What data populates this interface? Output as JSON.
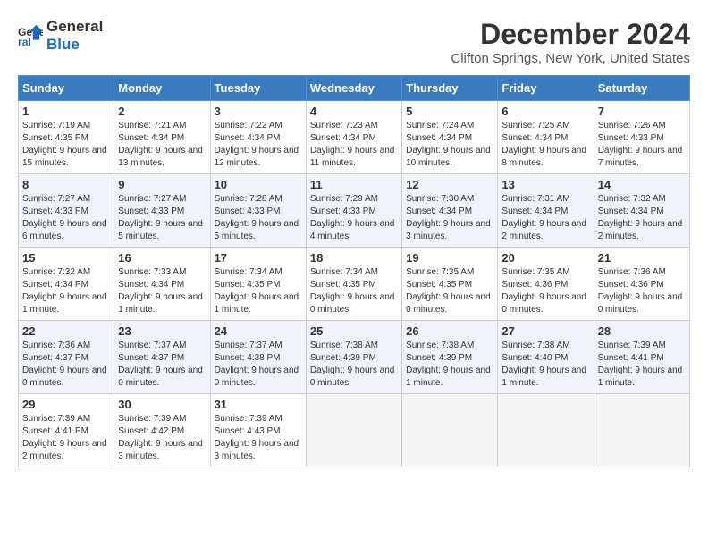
{
  "logo": {
    "line1": "General",
    "line2": "Blue"
  },
  "title": "December 2024",
  "subtitle": "Clifton Springs, New York, United States",
  "days_of_week": [
    "Sunday",
    "Monday",
    "Tuesday",
    "Wednesday",
    "Thursday",
    "Friday",
    "Saturday"
  ],
  "weeks": [
    [
      {
        "day": 1,
        "sunrise": "7:19 AM",
        "sunset": "4:35 PM",
        "daylight": "9 hours and 15 minutes."
      },
      {
        "day": 2,
        "sunrise": "7:21 AM",
        "sunset": "4:34 PM",
        "daylight": "9 hours and 13 minutes."
      },
      {
        "day": 3,
        "sunrise": "7:22 AM",
        "sunset": "4:34 PM",
        "daylight": "9 hours and 12 minutes."
      },
      {
        "day": 4,
        "sunrise": "7:23 AM",
        "sunset": "4:34 PM",
        "daylight": "9 hours and 11 minutes."
      },
      {
        "day": 5,
        "sunrise": "7:24 AM",
        "sunset": "4:34 PM",
        "daylight": "9 hours and 10 minutes."
      },
      {
        "day": 6,
        "sunrise": "7:25 AM",
        "sunset": "4:34 PM",
        "daylight": "9 hours and 8 minutes."
      },
      {
        "day": 7,
        "sunrise": "7:26 AM",
        "sunset": "4:33 PM",
        "daylight": "9 hours and 7 minutes."
      }
    ],
    [
      {
        "day": 8,
        "sunrise": "7:27 AM",
        "sunset": "4:33 PM",
        "daylight": "9 hours and 6 minutes."
      },
      {
        "day": 9,
        "sunrise": "7:27 AM",
        "sunset": "4:33 PM",
        "daylight": "9 hours and 5 minutes."
      },
      {
        "day": 10,
        "sunrise": "7:28 AM",
        "sunset": "4:33 PM",
        "daylight": "9 hours and 5 minutes."
      },
      {
        "day": 11,
        "sunrise": "7:29 AM",
        "sunset": "4:33 PM",
        "daylight": "9 hours and 4 minutes."
      },
      {
        "day": 12,
        "sunrise": "7:30 AM",
        "sunset": "4:34 PM",
        "daylight": "9 hours and 3 minutes."
      },
      {
        "day": 13,
        "sunrise": "7:31 AM",
        "sunset": "4:34 PM",
        "daylight": "9 hours and 2 minutes."
      },
      {
        "day": 14,
        "sunrise": "7:32 AM",
        "sunset": "4:34 PM",
        "daylight": "9 hours and 2 minutes."
      }
    ],
    [
      {
        "day": 15,
        "sunrise": "7:32 AM",
        "sunset": "4:34 PM",
        "daylight": "9 hours and 1 minute."
      },
      {
        "day": 16,
        "sunrise": "7:33 AM",
        "sunset": "4:34 PM",
        "daylight": "9 hours and 1 minute."
      },
      {
        "day": 17,
        "sunrise": "7:34 AM",
        "sunset": "4:35 PM",
        "daylight": "9 hours and 1 minute."
      },
      {
        "day": 18,
        "sunrise": "7:34 AM",
        "sunset": "4:35 PM",
        "daylight": "9 hours and 0 minutes."
      },
      {
        "day": 19,
        "sunrise": "7:35 AM",
        "sunset": "4:35 PM",
        "daylight": "9 hours and 0 minutes."
      },
      {
        "day": 20,
        "sunrise": "7:35 AM",
        "sunset": "4:36 PM",
        "daylight": "9 hours and 0 minutes."
      },
      {
        "day": 21,
        "sunrise": "7:36 AM",
        "sunset": "4:36 PM",
        "daylight": "9 hours and 0 minutes."
      }
    ],
    [
      {
        "day": 22,
        "sunrise": "7:36 AM",
        "sunset": "4:37 PM",
        "daylight": "9 hours and 0 minutes."
      },
      {
        "day": 23,
        "sunrise": "7:37 AM",
        "sunset": "4:37 PM",
        "daylight": "9 hours and 0 minutes."
      },
      {
        "day": 24,
        "sunrise": "7:37 AM",
        "sunset": "4:38 PM",
        "daylight": "9 hours and 0 minutes."
      },
      {
        "day": 25,
        "sunrise": "7:38 AM",
        "sunset": "4:39 PM",
        "daylight": "9 hours and 0 minutes."
      },
      {
        "day": 26,
        "sunrise": "7:38 AM",
        "sunset": "4:39 PM",
        "daylight": "9 hours and 1 minute."
      },
      {
        "day": 27,
        "sunrise": "7:38 AM",
        "sunset": "4:40 PM",
        "daylight": "9 hours and 1 minute."
      },
      {
        "day": 28,
        "sunrise": "7:39 AM",
        "sunset": "4:41 PM",
        "daylight": "9 hours and 1 minute."
      }
    ],
    [
      {
        "day": 29,
        "sunrise": "7:39 AM",
        "sunset": "4:41 PM",
        "daylight": "9 hours and 2 minutes."
      },
      {
        "day": 30,
        "sunrise": "7:39 AM",
        "sunset": "4:42 PM",
        "daylight": "9 hours and 3 minutes."
      },
      {
        "day": 31,
        "sunrise": "7:39 AM",
        "sunset": "4:43 PM",
        "daylight": "9 hours and 3 minutes."
      },
      null,
      null,
      null,
      null
    ]
  ]
}
